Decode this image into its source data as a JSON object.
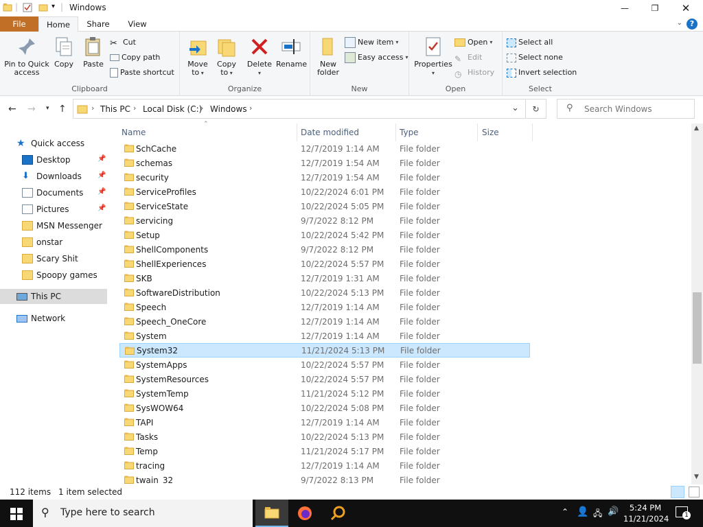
{
  "window": {
    "title": "Windows",
    "controls": {
      "minimize": "—",
      "maximize": "❐",
      "close": "✕"
    }
  },
  "ribbon_tabs": [
    "File",
    "Home",
    "Share",
    "View"
  ],
  "help_label": "?",
  "ribbon": {
    "clipboard": {
      "label": "Clipboard",
      "pin_label": [
        "Pin to Quick",
        "access"
      ],
      "copy_label": "Copy",
      "paste_label": "Paste",
      "cut_label": "Cut",
      "copy_path_label": "Copy path",
      "paste_shortcut_label": "Paste shortcut"
    },
    "organize": {
      "label": "Organize",
      "move_to_label": [
        "Move",
        "to"
      ],
      "copy_to_label": [
        "Copy",
        "to"
      ],
      "delete_label": "Delete",
      "rename_label": "Rename"
    },
    "new": {
      "label": "New",
      "new_folder_label": [
        "New",
        "folder"
      ],
      "new_item_label": "New item",
      "easy_access_label": "Easy access"
    },
    "open": {
      "label": "Open",
      "properties_label": "Properties",
      "open_label": "Open",
      "edit_label": "Edit",
      "history_label": "History"
    },
    "select": {
      "label": "Select",
      "select_all_label": "Select all",
      "select_none_label": "Select none",
      "invert_label": "Invert selection"
    }
  },
  "address": {
    "breadcrumbs": [
      "This PC",
      "Local Disk (C:)",
      "Windows"
    ],
    "search_placeholder": "Search Windows"
  },
  "nav_pane": {
    "quick_access_label": "Quick access",
    "items": [
      {
        "label": "Desktop",
        "pinned": true,
        "icon": "desktop-icon"
      },
      {
        "label": "Downloads",
        "pinned": true,
        "icon": "download-icon"
      },
      {
        "label": "Documents",
        "pinned": true,
        "icon": "documents-icon"
      },
      {
        "label": "Pictures",
        "pinned": true,
        "icon": "pictures-icon"
      },
      {
        "label": "MSN Messenger",
        "pinned": false,
        "icon": "folder-icon"
      },
      {
        "label": "onstar",
        "pinned": false,
        "icon": "folder-icon"
      },
      {
        "label": "Scary Shit",
        "pinned": false,
        "icon": "folder-icon"
      },
      {
        "label": "Spoopy games",
        "pinned": false,
        "icon": "folder-icon"
      }
    ],
    "this_pc_label": "This PC",
    "network_label": "Network"
  },
  "file_list": {
    "columns": [
      "Name",
      "Date modified",
      "Type",
      "Size"
    ],
    "rows": [
      {
        "name": "SchCache",
        "date": "12/7/2019 1:14 AM",
        "type": "File folder"
      },
      {
        "name": "schemas",
        "date": "12/7/2019 1:54 AM",
        "type": "File folder"
      },
      {
        "name": "security",
        "date": "12/7/2019 1:54 AM",
        "type": "File folder"
      },
      {
        "name": "ServiceProfiles",
        "date": "10/22/2024 6:01 PM",
        "type": "File folder"
      },
      {
        "name": "ServiceState",
        "date": "10/22/2024 5:05 PM",
        "type": "File folder"
      },
      {
        "name": "servicing",
        "date": "9/7/2022 8:12 PM",
        "type": "File folder"
      },
      {
        "name": "Setup",
        "date": "10/22/2024 5:42 PM",
        "type": "File folder"
      },
      {
        "name": "ShellComponents",
        "date": "9/7/2022 8:12 PM",
        "type": "File folder"
      },
      {
        "name": "ShellExperiences",
        "date": "10/22/2024 5:57 PM",
        "type": "File folder"
      },
      {
        "name": "SKB",
        "date": "12/7/2019 1:31 AM",
        "type": "File folder"
      },
      {
        "name": "SoftwareDistribution",
        "date": "10/22/2024 5:13 PM",
        "type": "File folder"
      },
      {
        "name": "Speech",
        "date": "12/7/2019 1:14 AM",
        "type": "File folder"
      },
      {
        "name": "Speech_OneCore",
        "date": "12/7/2019 1:14 AM",
        "type": "File folder"
      },
      {
        "name": "System",
        "date": "12/7/2019 1:14 AM",
        "type": "File folder"
      },
      {
        "name": "System32",
        "date": "11/21/2024 5:13 PM",
        "type": "File folder",
        "selected": true
      },
      {
        "name": "SystemApps",
        "date": "10/22/2024 5:57 PM",
        "type": "File folder"
      },
      {
        "name": "SystemResources",
        "date": "10/22/2024 5:57 PM",
        "type": "File folder"
      },
      {
        "name": "SystemTemp",
        "date": "11/21/2024 5:12 PM",
        "type": "File folder"
      },
      {
        "name": "SysWOW64",
        "date": "10/22/2024 5:08 PM",
        "type": "File folder"
      },
      {
        "name": "TAPI",
        "date": "12/7/2019 1:14 AM",
        "type": "File folder"
      },
      {
        "name": "Tasks",
        "date": "10/22/2024 5:13 PM",
        "type": "File folder"
      },
      {
        "name": "Temp",
        "date": "11/21/2024 5:17 PM",
        "type": "File folder"
      },
      {
        "name": "tracing",
        "date": "12/7/2019 1:14 AM",
        "type": "File folder"
      },
      {
        "name": "twain_32",
        "date": "9/7/2022 8:13 PM",
        "type": "File folder"
      }
    ]
  },
  "status": {
    "item_count": "112 items",
    "selection": "1 item selected"
  },
  "taskbar": {
    "search_placeholder": "Type here to search",
    "time": "5:24 PM",
    "date": "11/21/2024",
    "notification_count": "1"
  },
  "colors": {
    "file_tab": "#c16f27",
    "selection_bg": "#cce8ff",
    "selection_border": "#99d1ff",
    "folder_yellow": "#f8d775",
    "accent_blue": "#1a73c6"
  }
}
